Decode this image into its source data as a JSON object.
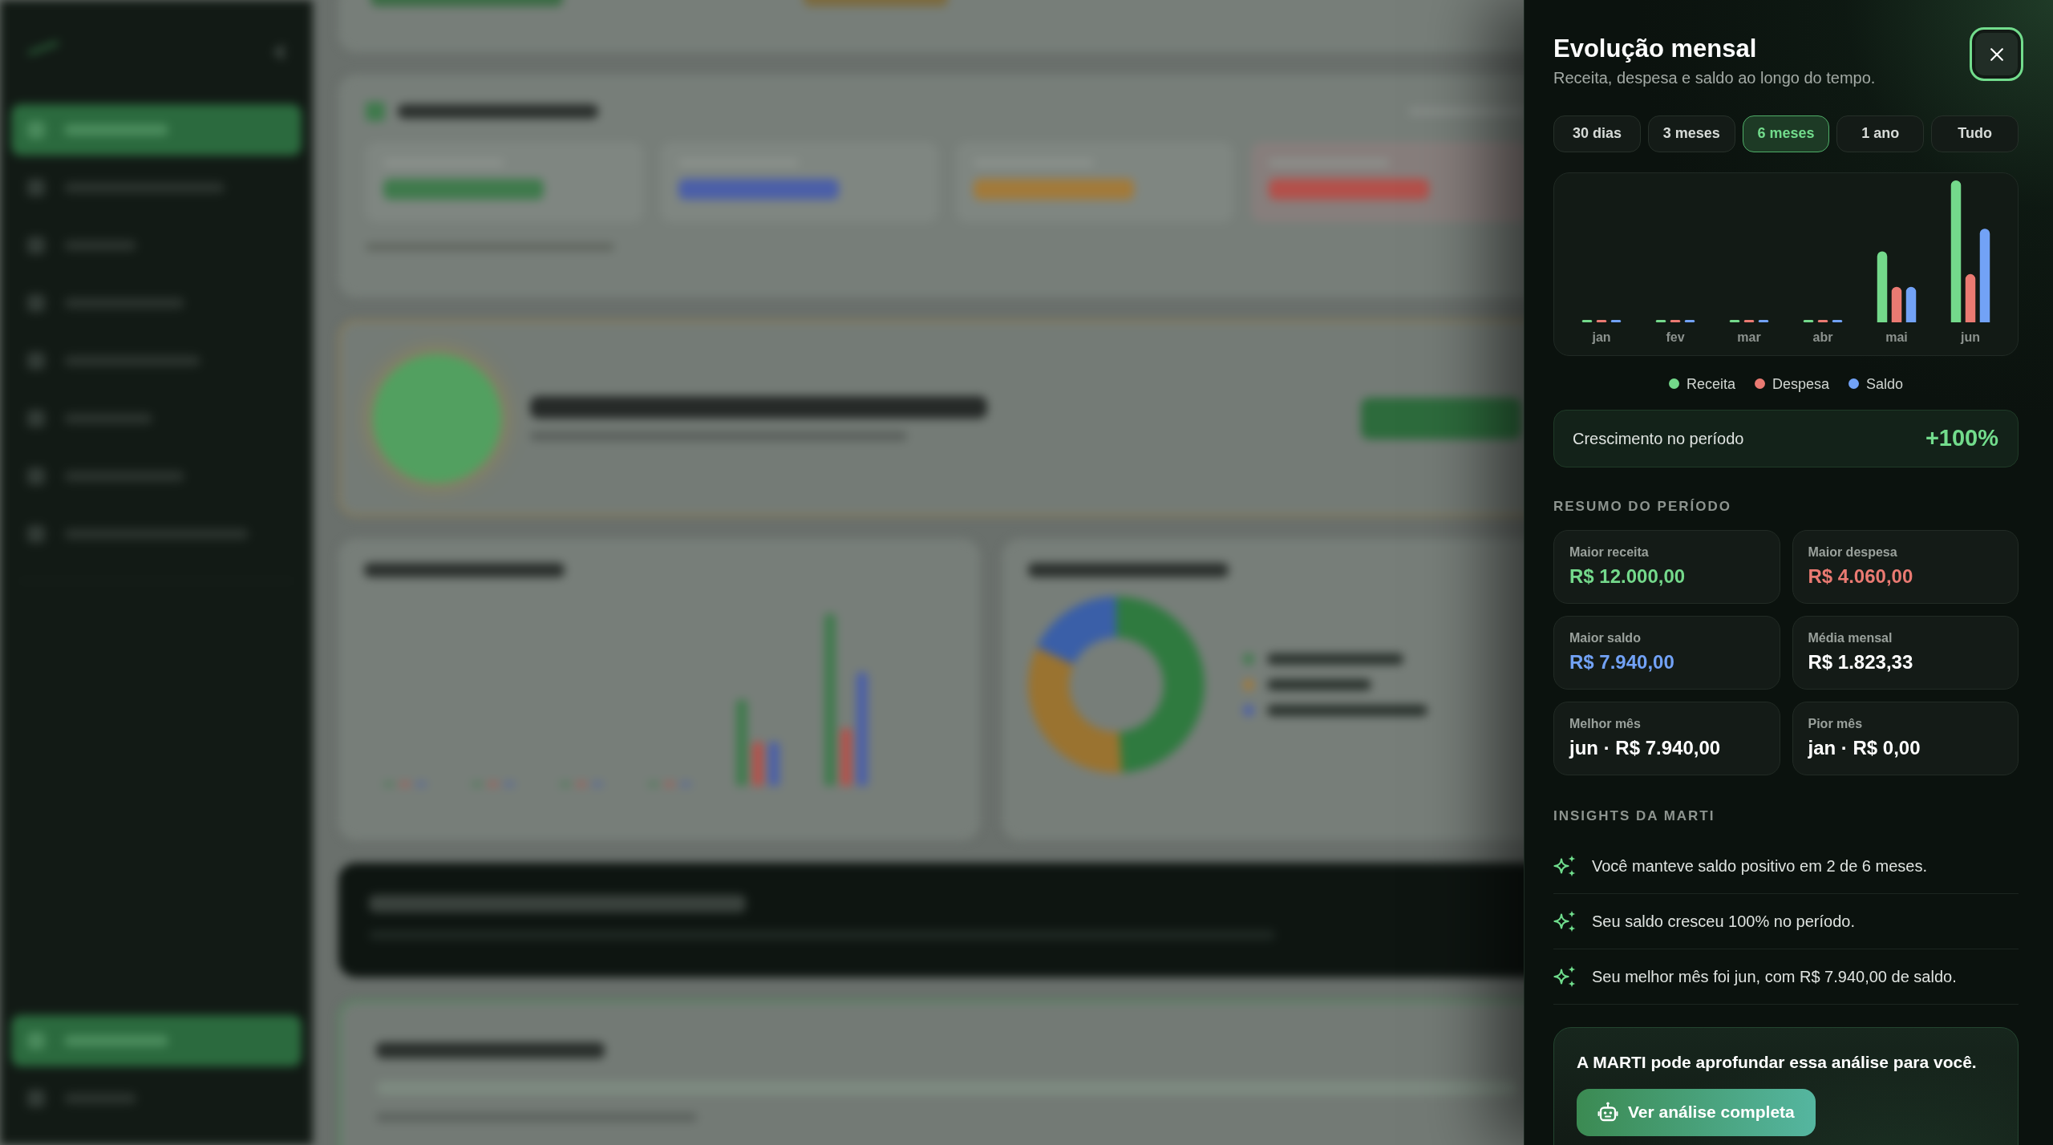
{
  "panel": {
    "title": "Evolução mensal",
    "subtitle": "Receita, despesa e saldo ao longo do tempo.",
    "periods": [
      {
        "label": "30 dias",
        "selected": false
      },
      {
        "label": "3 meses",
        "selected": false
      },
      {
        "label": "6 meses",
        "selected": true
      },
      {
        "label": "1 ano",
        "selected": false
      },
      {
        "label": "Tudo",
        "selected": false
      }
    ],
    "chart": {
      "months": [
        "jan",
        "fev",
        "mar",
        "abr",
        "mai",
        "jun"
      ],
      "legend": [
        {
          "label": "Receita",
          "color": "#74d98b"
        },
        {
          "label": "Despesa",
          "color": "#ea7a72"
        },
        {
          "label": "Saldo",
          "color": "#72a2f6"
        }
      ]
    },
    "growth": {
      "label": "Crescimento no período",
      "value": "+100%"
    },
    "summary": {
      "heading": "RESUMO DO PERÍODO",
      "cards": [
        {
          "label": "Maior receita",
          "value": "R$ 12.000,00",
          "color": "#74d98b"
        },
        {
          "label": "Maior despesa",
          "value": "R$ 4.060,00",
          "color": "#ea7a72"
        },
        {
          "label": "Maior saldo",
          "value": "R$ 7.940,00",
          "color": "#72a2f6"
        },
        {
          "label": "Média mensal",
          "value": "R$ 1.823,33",
          "color": "#ffffff"
        },
        {
          "label": "Melhor mês",
          "value": "jun · R$ 7.940,00",
          "color": "#ffffff"
        },
        {
          "label": "Pior mês",
          "value": "jan · R$ 0,00",
          "color": "#ffffff"
        }
      ]
    },
    "insights": {
      "heading": "INSIGHTS DA MARTI",
      "items": [
        "Você manteve saldo positivo em 2 de 6 meses.",
        "Seu saldo cresceu 100% no período.",
        "Seu melhor mês foi jun, com R$ 7.940,00 de saldo."
      ]
    },
    "cta": {
      "text": "A MARTI pode aprofundar essa análise para você.",
      "button": "Ver análise completa"
    }
  }
}
